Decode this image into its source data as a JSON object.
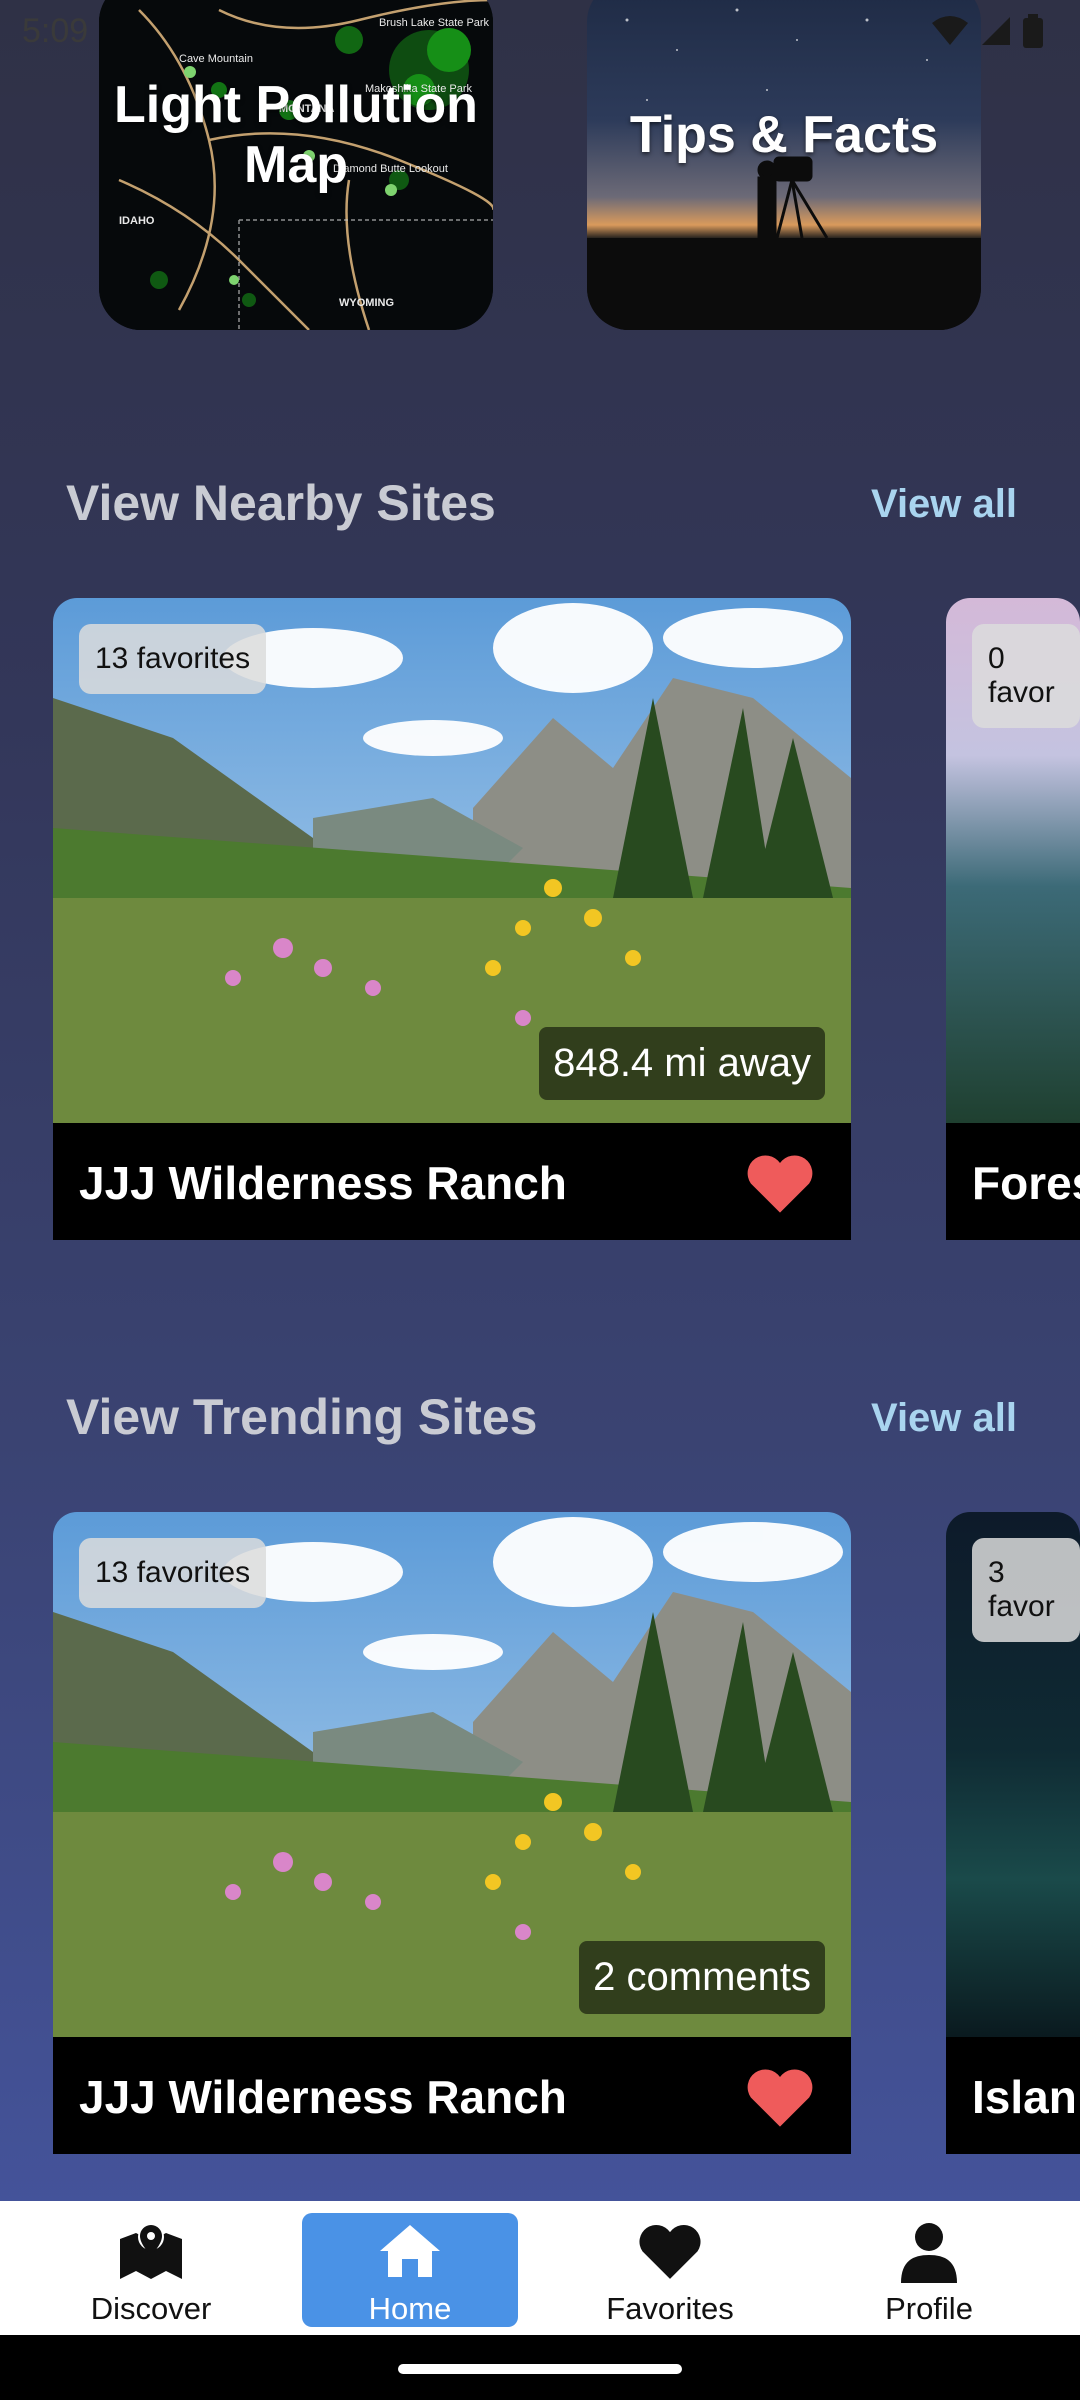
{
  "status_bar": {
    "time": "5:09"
  },
  "tiles": [
    {
      "title": "Light Pollution Map"
    },
    {
      "title": "Tips & Facts"
    }
  ],
  "map_labels": [
    "Cave Mountain",
    "Brush Lake State Park",
    "MONTANA",
    "Makoshika State Park",
    "Diamond Butte Lookout",
    "IDAHO",
    "WYOMING"
  ],
  "nearby": {
    "title": "View Nearby Sites",
    "view_all": "View all",
    "cards": [
      {
        "name": "JJJ Wilderness Ranch",
        "favorites": "13 favorites",
        "info": "848.4 mi away"
      },
      {
        "name": "Fores",
        "favorites": "0 favor"
      }
    ]
  },
  "trending": {
    "title": "View Trending Sites",
    "view_all": "View all",
    "cards": [
      {
        "name": "JJJ Wilderness Ranch",
        "favorites": "13 favorites",
        "info": "2 comments"
      },
      {
        "name": "Islan",
        "favorites": "3 favor"
      }
    ]
  },
  "bottom_nav": [
    {
      "label": "Discover",
      "icon": "map-icon"
    },
    {
      "label": "Home",
      "icon": "home-icon",
      "active": true
    },
    {
      "label": "Favorites",
      "icon": "heart-icon"
    },
    {
      "label": "Profile",
      "icon": "person-icon"
    }
  ],
  "colors": {
    "accent": "#4a92e6",
    "heart": "#ef5b5b",
    "view_all": "#a9d4ef"
  }
}
